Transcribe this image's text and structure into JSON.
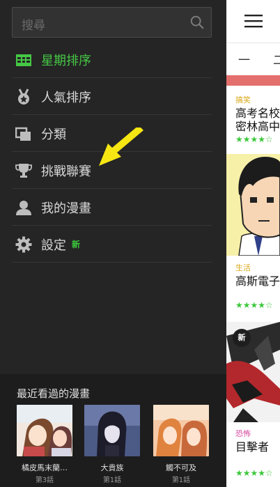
{
  "drawer": {
    "search": {
      "placeholder": "搜尋",
      "icon": "search-icon"
    },
    "menu": [
      {
        "label": "星期排序",
        "icon": "calendar-grid-icon",
        "active": true
      },
      {
        "label": "人氣排序",
        "icon": "medal-icon",
        "active": false
      },
      {
        "label": "分類",
        "icon": "stack-icon",
        "active": false
      },
      {
        "label": "挑戰聯賽",
        "icon": "trophy-icon",
        "active": false
      },
      {
        "label": "我的漫畫",
        "icon": "person-icon",
        "active": false
      },
      {
        "label": "設定",
        "icon": "gear-icon",
        "active": false,
        "badge": "新"
      }
    ],
    "recent": {
      "title": "最近看過的漫畫",
      "items": [
        {
          "name": "橘皮馬末蘭…",
          "episode": "第3話"
        },
        {
          "name": "大貴族",
          "episode": "第1話"
        },
        {
          "name": "觸不可及",
          "episode": "第1話"
        }
      ]
    }
  },
  "content": {
    "day_tabs": [
      "一",
      "二"
    ],
    "cards": [
      {
        "genre": "搞笑",
        "title_line1": "高考名校",
        "title_line2": "密林高中",
        "rating": "★★★★☆"
      },
      {
        "genre": "生活",
        "title_line1": "高斯電子",
        "rating": "★★★★☆"
      },
      {
        "genre": "恐怖",
        "title_line1": "目擊者",
        "rating": "★★★★☆",
        "badge": "新"
      }
    ]
  },
  "colors": {
    "drawer_bg": "#252525",
    "accent_green": "#45c845",
    "genre_comedy": "#d9a91c",
    "genre_life": "#d9a91c",
    "genre_horror": "#d64aa0",
    "arrow_yellow": "#f6e612"
  }
}
